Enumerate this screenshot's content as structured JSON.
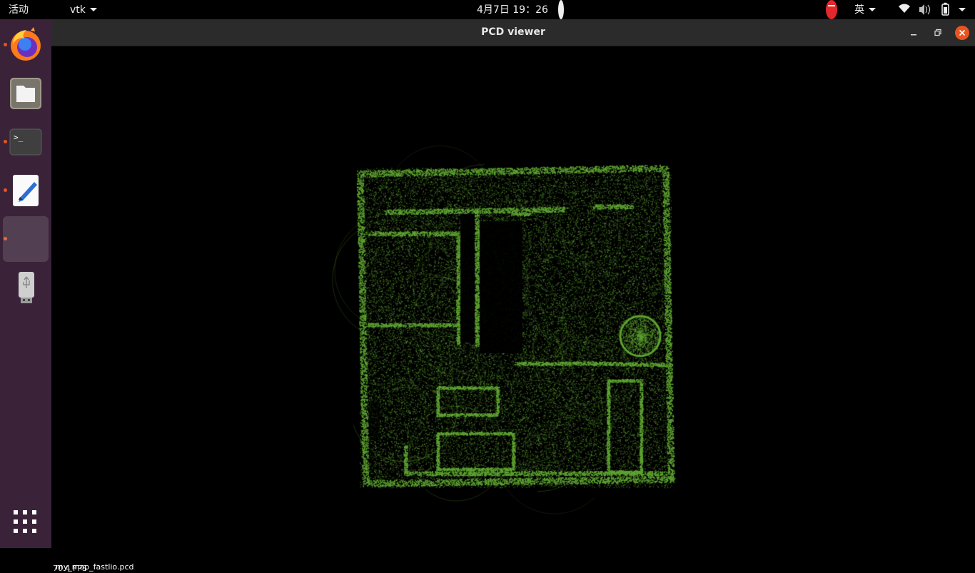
{
  "topbar": {
    "activities": "活动",
    "app_menu": "vtk",
    "clock": "4月7日  19：26",
    "language": "英"
  },
  "dock": {
    "apps": [
      {
        "name": "firefox",
        "running": true
      },
      {
        "name": "files",
        "running": false
      },
      {
        "name": "terminal",
        "running": true,
        "glyph": ">_"
      },
      {
        "name": "text-editor",
        "running": true
      },
      {
        "name": "pcd-viewer",
        "running": true,
        "active": true
      },
      {
        "name": "usb-drive",
        "running": false
      }
    ]
  },
  "window": {
    "title": "PCD viewer"
  },
  "viewer": {
    "status_fps": "70.4 FPS",
    "status_file": "my_map_fastlio.pcd",
    "point_color": "#5ea431"
  },
  "colors": {
    "dock_bg": "#3a2339",
    "accent": "#e95420",
    "titlebar": "#2b2b2b"
  }
}
